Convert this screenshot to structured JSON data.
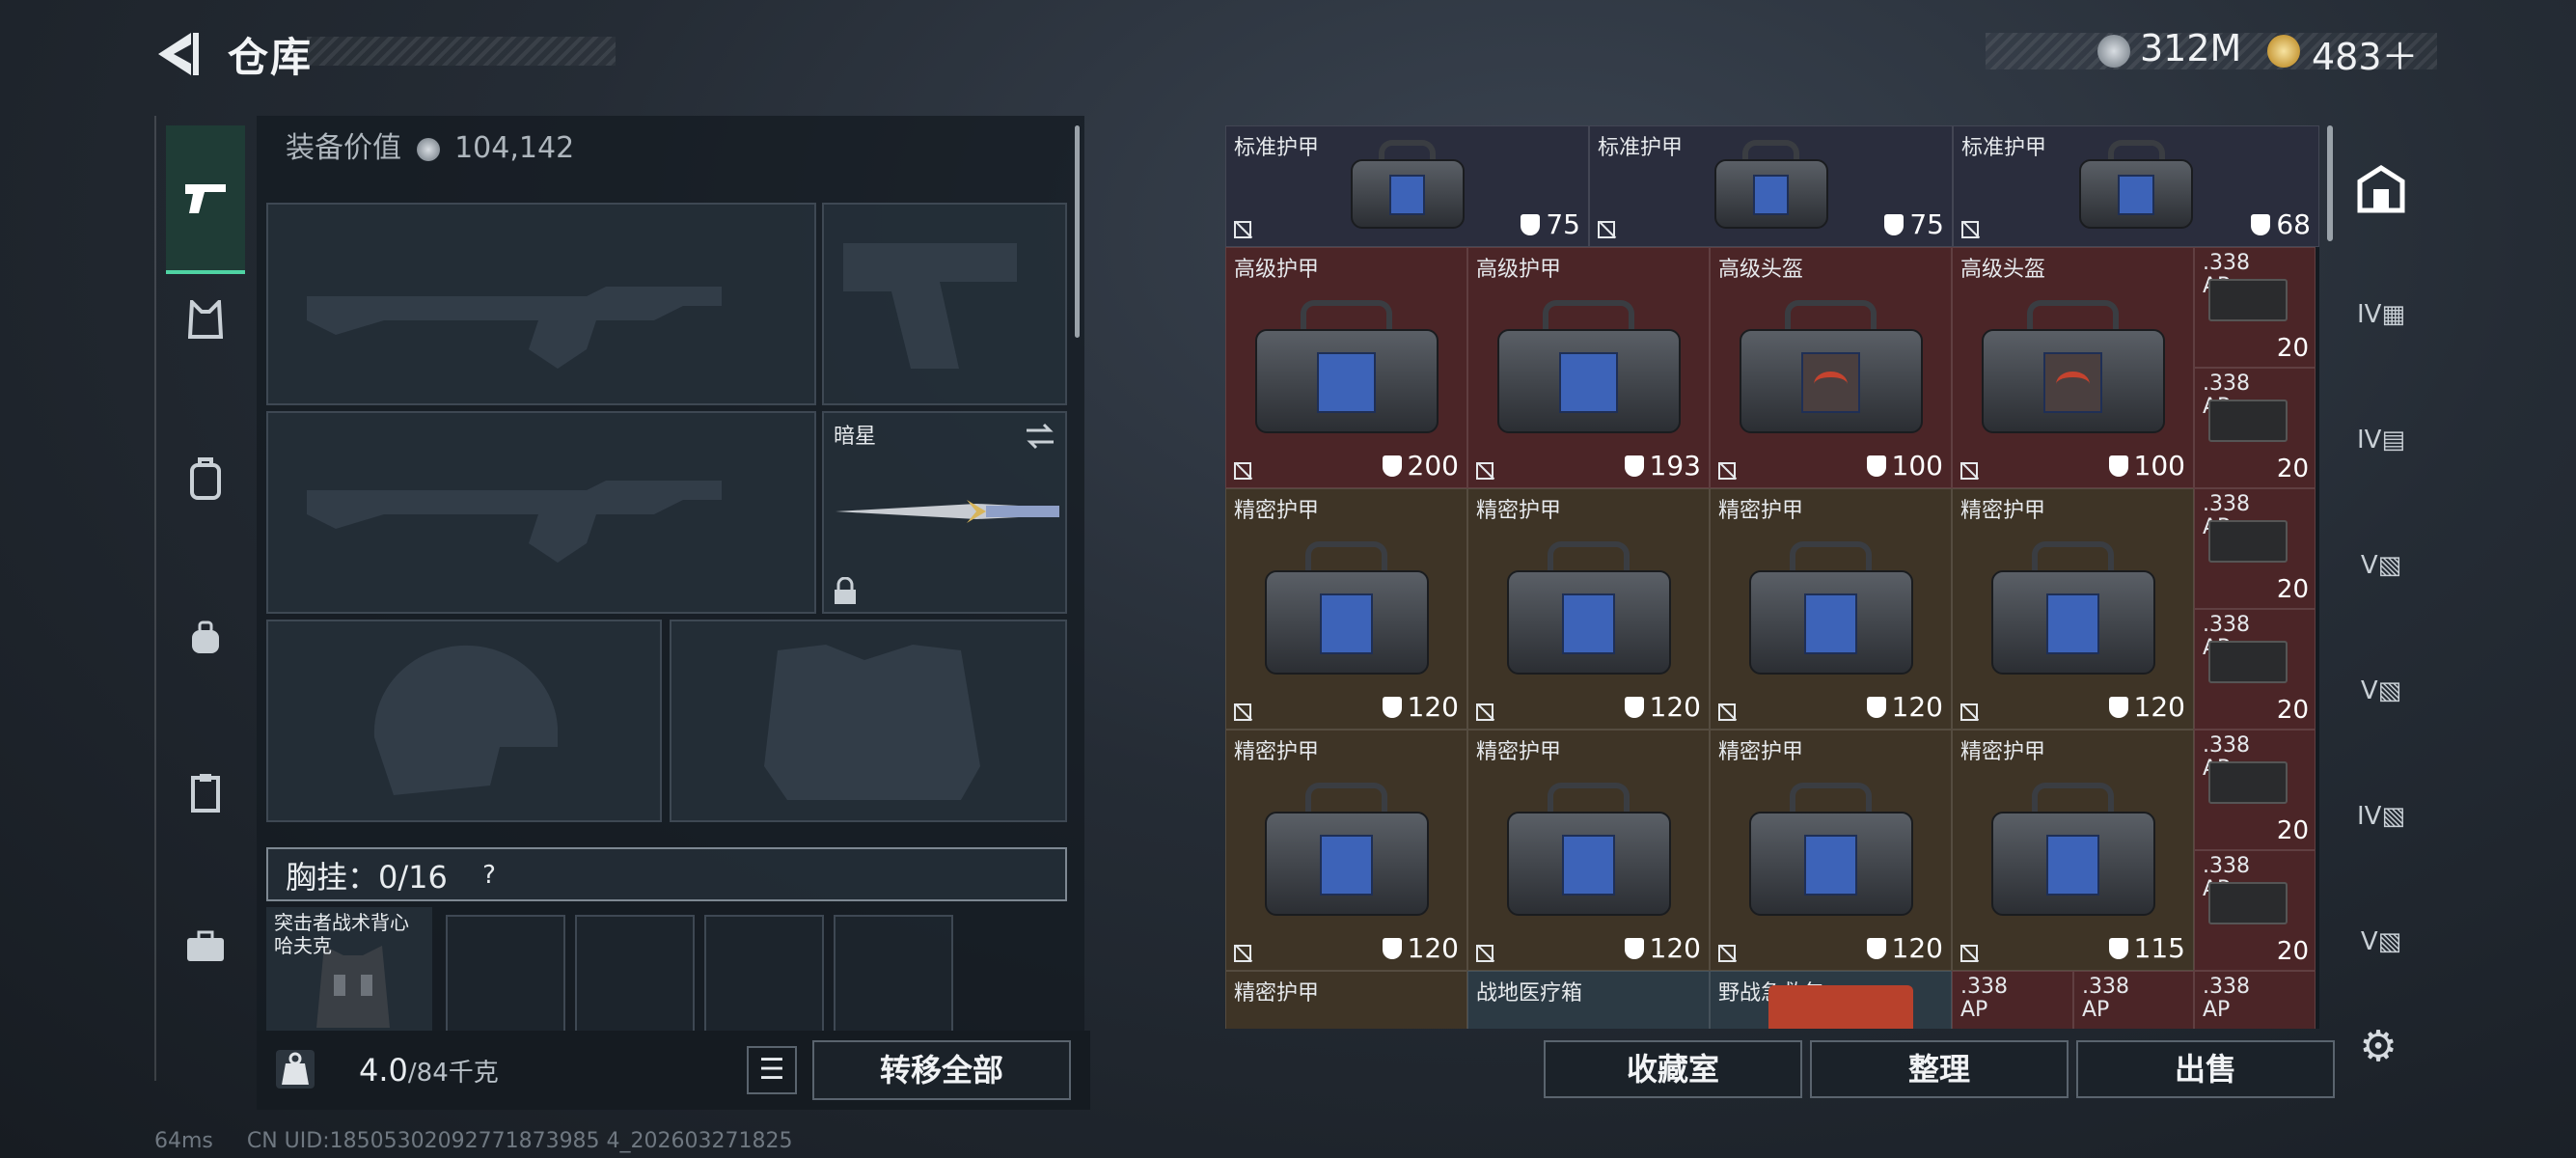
{
  "header": {
    "title": "仓库",
    "currency_silver": "312M",
    "currency_gold": "483＋"
  },
  "equipment": {
    "value_label": "装备价值",
    "value": "104,142",
    "knife_name": "暗星",
    "chest_label": "胸挂：0/16",
    "chest_help": "?",
    "vest_name": "突击者战术背心 哈夫克"
  },
  "weight": {
    "current": "4.0",
    "max": "/84千克"
  },
  "buttons": {
    "transfer_all": "转移全部",
    "collection": "收藏室",
    "organize": "整理",
    "sell": "出售"
  },
  "storage": {
    "items": [
      {
        "name": "标准护甲",
        "value": "75"
      },
      {
        "name": "标准护甲",
        "value": "75"
      },
      {
        "name": "标准护甲",
        "value": "68"
      },
      {
        "name": "高级护甲",
        "value": "200"
      },
      {
        "name": "高级护甲",
        "value": "193"
      },
      {
        "name": "高级头盔",
        "value": "100"
      },
      {
        "name": "高级头盔",
        "value": "100"
      },
      {
        "name": "精密护甲",
        "value": "120"
      },
      {
        "name": "精密护甲",
        "value": "120"
      },
      {
        "name": "精密护甲",
        "value": "120"
      },
      {
        "name": "精密护甲",
        "value": "120"
      },
      {
        "name": "精密护甲",
        "value": "120"
      },
      {
        "name": "精密护甲",
        "value": "120"
      },
      {
        "name": "精密护甲",
        "value": "120"
      },
      {
        "name": "精密护甲",
        "value": "115"
      },
      {
        "name": "精密护甲",
        "value": ""
      },
      {
        "name": "战地医疗箱",
        "value": ""
      },
      {
        "name": "野战急救包",
        "value": ""
      }
    ],
    "ammo": [
      {
        "label": ".338 AP",
        "qty": "20"
      },
      {
        "label": ".338 AP",
        "qty": "20"
      },
      {
        "label": ".338 AP",
        "qty": "20"
      },
      {
        "label": ".338 AP",
        "qty": "20"
      },
      {
        "label": ".338 AP",
        "qty": "20"
      },
      {
        "label": ".338 AP",
        "qty": "20"
      },
      {
        "label": ".338 AP",
        "qty": ""
      },
      {
        "label": ".338 AP",
        "qty": ""
      },
      {
        "label": ".338 AP",
        "qty": ""
      }
    ]
  },
  "footer": {
    "ping": "64ms",
    "uid": "CN UID:18505302092771873985 4_202603271825"
  },
  "colors": {
    "accent": "#4fd3a3",
    "armor_std": "#2a2d3d",
    "armor_red": "#4b2527",
    "armor_brown": "#3e3426"
  }
}
